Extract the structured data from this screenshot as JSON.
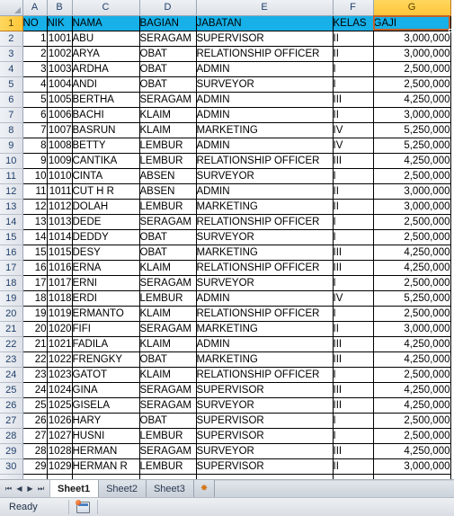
{
  "spreadsheet": {
    "column_headers": [
      "A",
      "B",
      "C",
      "D",
      "E",
      "F",
      "G"
    ],
    "selected_column": "G",
    "active_cell": "G1",
    "colors": {
      "table_header_fill": "#17b0e8",
      "selected_header_fill": "#ffc63a",
      "active_cell_border": "#c0622a",
      "grid_line": "#000000"
    },
    "table_headers": [
      "NO",
      "NIK",
      "NAMA",
      "BAGIAN",
      "JABATAN",
      "KELAS",
      "GAJI"
    ],
    "rows": [
      {
        "row": "2",
        "no": "1",
        "nik": "1001",
        "nama": "ABU",
        "bagian": "SERAGAM",
        "jabatan": "SUPERVISOR",
        "kelas": "II",
        "gaji": "3,000,000"
      },
      {
        "row": "3",
        "no": "2",
        "nik": "1002",
        "nama": "ARYA",
        "bagian": "OBAT",
        "jabatan": "RELATIONSHIP OFFICER",
        "kelas": "II",
        "gaji": "3,000,000"
      },
      {
        "row": "4",
        "no": "3",
        "nik": "1003",
        "nama": "ARDHA",
        "bagian": "OBAT",
        "jabatan": "ADMIN",
        "kelas": "I",
        "gaji": "2,500,000"
      },
      {
        "row": "5",
        "no": "4",
        "nik": "1004",
        "nama": "ANDI",
        "bagian": "OBAT",
        "jabatan": "SURVEYOR",
        "kelas": "I",
        "gaji": "2,500,000"
      },
      {
        "row": "6",
        "no": "5",
        "nik": "1005",
        "nama": "BERTHA",
        "bagian": "SERAGAM",
        "jabatan": "ADMIN",
        "kelas": "III",
        "gaji": "4,250,000"
      },
      {
        "row": "7",
        "no": "6",
        "nik": "1006",
        "nama": "BACHI",
        "bagian": "KLAIM",
        "jabatan": "ADMIN",
        "kelas": "II",
        "gaji": "3,000,000"
      },
      {
        "row": "8",
        "no": "7",
        "nik": "1007",
        "nama": "BASRUN",
        "bagian": "KLAIM",
        "jabatan": "MARKETING",
        "kelas": "IV",
        "gaji": "5,250,000"
      },
      {
        "row": "9",
        "no": "8",
        "nik": "1008",
        "nama": "BETTY",
        "bagian": "LEMBUR",
        "jabatan": "ADMIN",
        "kelas": "IV",
        "gaji": "5,250,000"
      },
      {
        "row": "10",
        "no": "9",
        "nik": "1009",
        "nama": "CANTIKA",
        "bagian": "LEMBUR",
        "jabatan": "RELATIONSHIP OFFICER",
        "kelas": "III",
        "gaji": "4,250,000"
      },
      {
        "row": "11",
        "no": "10",
        "nik": "1010",
        "nama": "CINTA",
        "bagian": "ABSEN",
        "jabatan": "SURVEYOR",
        "kelas": "I",
        "gaji": "2,500,000"
      },
      {
        "row": "12",
        "no": "11",
        "nik": "1011",
        "nama": "CUT H R",
        "bagian": "ABSEN",
        "jabatan": "ADMIN",
        "kelas": "II",
        "gaji": "3,000,000"
      },
      {
        "row": "13",
        "no": "12",
        "nik": "1012",
        "nama": "DOLAH",
        "bagian": "LEMBUR",
        "jabatan": "MARKETING",
        "kelas": "II",
        "gaji": "3,000,000"
      },
      {
        "row": "14",
        "no": "13",
        "nik": "1013",
        "nama": "DEDE",
        "bagian": "SERAGAM",
        "jabatan": "RELATIONSHIP OFFICER",
        "kelas": "I",
        "gaji": "2,500,000"
      },
      {
        "row": "15",
        "no": "14",
        "nik": "1014",
        "nama": "DEDDY",
        "bagian": "OBAT",
        "jabatan": "SURVEYOR",
        "kelas": "I",
        "gaji": "2,500,000"
      },
      {
        "row": "16",
        "no": "15",
        "nik": "1015",
        "nama": "DESY",
        "bagian": "OBAT",
        "jabatan": "MARKETING",
        "kelas": "III",
        "gaji": "4,250,000"
      },
      {
        "row": "17",
        "no": "16",
        "nik": "1016",
        "nama": "ERNA",
        "bagian": "KLAIM",
        "jabatan": "RELATIONSHIP OFFICER",
        "kelas": "III",
        "gaji": "4,250,000"
      },
      {
        "row": "18",
        "no": "17",
        "nik": "1017",
        "nama": "ERNI",
        "bagian": "SERAGAM",
        "jabatan": "SURVEYOR",
        "kelas": "I",
        "gaji": "2,500,000"
      },
      {
        "row": "19",
        "no": "18",
        "nik": "1018",
        "nama": "ERDI",
        "bagian": "LEMBUR",
        "jabatan": "ADMIN",
        "kelas": "IV",
        "gaji": "5,250,000"
      },
      {
        "row": "20",
        "no": "19",
        "nik": "1019",
        "nama": "ERMANTO",
        "bagian": "KLAIM",
        "jabatan": "RELATIONSHIP OFFICER",
        "kelas": "I",
        "gaji": "2,500,000"
      },
      {
        "row": "21",
        "no": "20",
        "nik": "1020",
        "nama": "FIFI",
        "bagian": "SERAGAM",
        "jabatan": "MARKETING",
        "kelas": "II",
        "gaji": "3,000,000"
      },
      {
        "row": "22",
        "no": "21",
        "nik": "1021",
        "nama": "FADILA",
        "bagian": "KLAIM",
        "jabatan": "ADMIN",
        "kelas": "III",
        "gaji": "4,250,000"
      },
      {
        "row": "23",
        "no": "22",
        "nik": "1022",
        "nama": "FRENGKY",
        "bagian": "OBAT",
        "jabatan": "MARKETING",
        "kelas": "III",
        "gaji": "4,250,000"
      },
      {
        "row": "24",
        "no": "23",
        "nik": "1023",
        "nama": "GATOT",
        "bagian": "KLAIM",
        "jabatan": "RELATIONSHIP OFFICER",
        "kelas": "I",
        "gaji": "2,500,000"
      },
      {
        "row": "25",
        "no": "24",
        "nik": "1024",
        "nama": "GINA",
        "bagian": "SERAGAM",
        "jabatan": "SUPERVISOR",
        "kelas": "III",
        "gaji": "4,250,000"
      },
      {
        "row": "26",
        "no": "25",
        "nik": "1025",
        "nama": "GISELA",
        "bagian": "SERAGAM",
        "jabatan": "SURVEYOR",
        "kelas": "III",
        "gaji": "4,250,000"
      },
      {
        "row": "27",
        "no": "26",
        "nik": "1026",
        "nama": "HARY",
        "bagian": "OBAT",
        "jabatan": "SUPERVISOR",
        "kelas": "I",
        "gaji": "2,500,000"
      },
      {
        "row": "28",
        "no": "27",
        "nik": "1027",
        "nama": "HUSNI",
        "bagian": "LEMBUR",
        "jabatan": "SUPERVISOR",
        "kelas": "I",
        "gaji": "2,500,000"
      },
      {
        "row": "29",
        "no": "28",
        "nik": "1028",
        "nama": "HERMAN",
        "bagian": "SERAGAM",
        "jabatan": "SURVEYOR",
        "kelas": "III",
        "gaji": "4,250,000"
      },
      {
        "row": "30",
        "no": "29",
        "nik": "1029",
        "nama": "HERMAN R",
        "bagian": "LEMBUR",
        "jabatan": "SUPERVISOR",
        "kelas": "II",
        "gaji": "3,000,000"
      }
    ]
  },
  "tabbar": {
    "nav": [
      {
        "name": "first-sheet",
        "glyph": "⏮"
      },
      {
        "name": "prev-sheet",
        "glyph": "◀"
      },
      {
        "name": "next-sheet",
        "glyph": "▶"
      },
      {
        "name": "last-sheet",
        "glyph": "⏭"
      }
    ],
    "sheets": [
      {
        "label": "Sheet1",
        "active": true
      },
      {
        "label": "Sheet2",
        "active": false
      },
      {
        "label": "Sheet3",
        "active": false
      }
    ],
    "new_sheet_icon": "✸"
  },
  "statusbar": {
    "status": "Ready"
  }
}
